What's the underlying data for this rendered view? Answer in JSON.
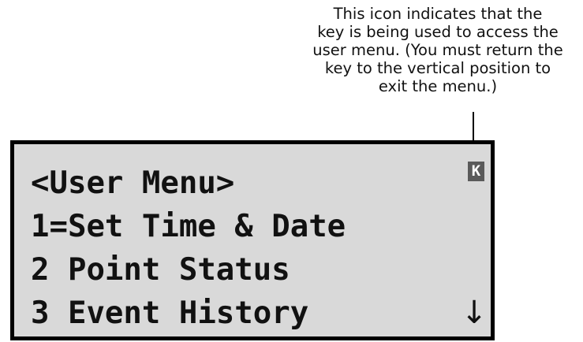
{
  "annotation": {
    "lines": [
      "This icon indicates that the",
      "key is being used to access the",
      "user menu. (You must return the",
      "key to the vertical position to",
      "exit the menu.)"
    ]
  },
  "display": {
    "title": "<User Menu>",
    "items": [
      "1=Set Time & Date",
      "2 Point Status",
      "3 Event History"
    ],
    "key_icon_glyph": "K",
    "key_icon_name": "key-mode-icon",
    "scroll_glyph": "↓",
    "scroll_icon_name": "scroll-down-arrow-icon",
    "colors": {
      "screen_bg": "#d9d9d9",
      "border": "#000000",
      "icon_bg": "#5a5a5a",
      "text": "#111111"
    }
  }
}
